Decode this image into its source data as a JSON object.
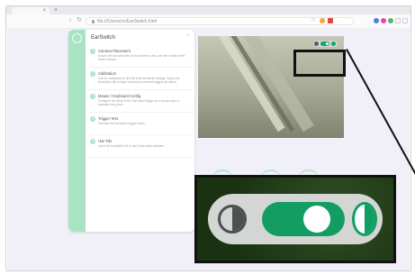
{
  "browser": {
    "tab_close_label": "×",
    "new_tab_label": "+",
    "url": "file:///Users/xx/EarSwitch.html"
  },
  "app": {
    "title": "EarSwitch",
    "collapse_icon": "chevron-up-icon",
    "steps": [
      {
        "index": "1",
        "title": "Camera Placement",
        "desc": "Ensure the ear canal lies in the camera's view, with the middle of the frame centred."
      },
      {
        "index": "2",
        "title": "Calibration",
        "desc": "Use the calibration to find the best sensitivity settings. Adjust the threshold until a single voluntary movement triggers an action."
      },
      {
        "index": "3",
        "title": "Mouse / Keyboard Config",
        "desc": "Configure the result of the EarSwitch trigger as a mouse click or keyboard key press."
      },
      {
        "index": "4",
        "title": "Trigger Test",
        "desc": "Test that the EarSwitch trigger works."
      },
      {
        "index": "5",
        "title": "Use File",
        "desc": "Open the EarSwitch file to use it with other software."
      }
    ],
    "footer": "—"
  },
  "camera": {
    "toggle_state": "on",
    "left_icon": "contrast-icon",
    "right_icon": "contrast-active-icon"
  },
  "colors": {
    "accent": "#139d63",
    "rail": "#a9e3c3",
    "page_bg": "#f1f0f8"
  }
}
